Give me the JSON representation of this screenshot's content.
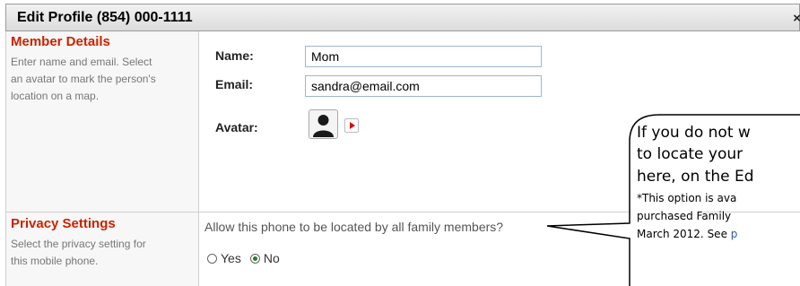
{
  "dialog": {
    "title": "Edit Profile (854) 000-1111",
    "close_glyph": "×"
  },
  "member_details": {
    "title": "Member Details",
    "desc_lines": [
      "Enter name and email. Select",
      "an avatar to mark the person's",
      "location on a map."
    ],
    "name_label": "Name:",
    "name_value": "Mom",
    "email_label": "Email:",
    "email_value": "sandra@email.com",
    "avatar_label": "Avatar:"
  },
  "privacy_settings": {
    "title": "Privacy Settings",
    "desc_lines": [
      "Select the privacy setting for",
      "this mobile phone."
    ],
    "question": "Allow this phone to be located by all family members?",
    "options": [
      {
        "label": "Yes",
        "checked": false
      },
      {
        "label": "No",
        "checked": true
      }
    ]
  },
  "callout": {
    "lines": [
      "If you do not w",
      "to locate your",
      "here, on the Ed"
    ],
    "note_lines": [
      "*This option is ava",
      "purchased Family",
      "March 2012. See "
    ],
    "note_link": "p"
  },
  "colors": {
    "section_title": "#cc2200",
    "radio_checked": "#2a7a2a"
  }
}
